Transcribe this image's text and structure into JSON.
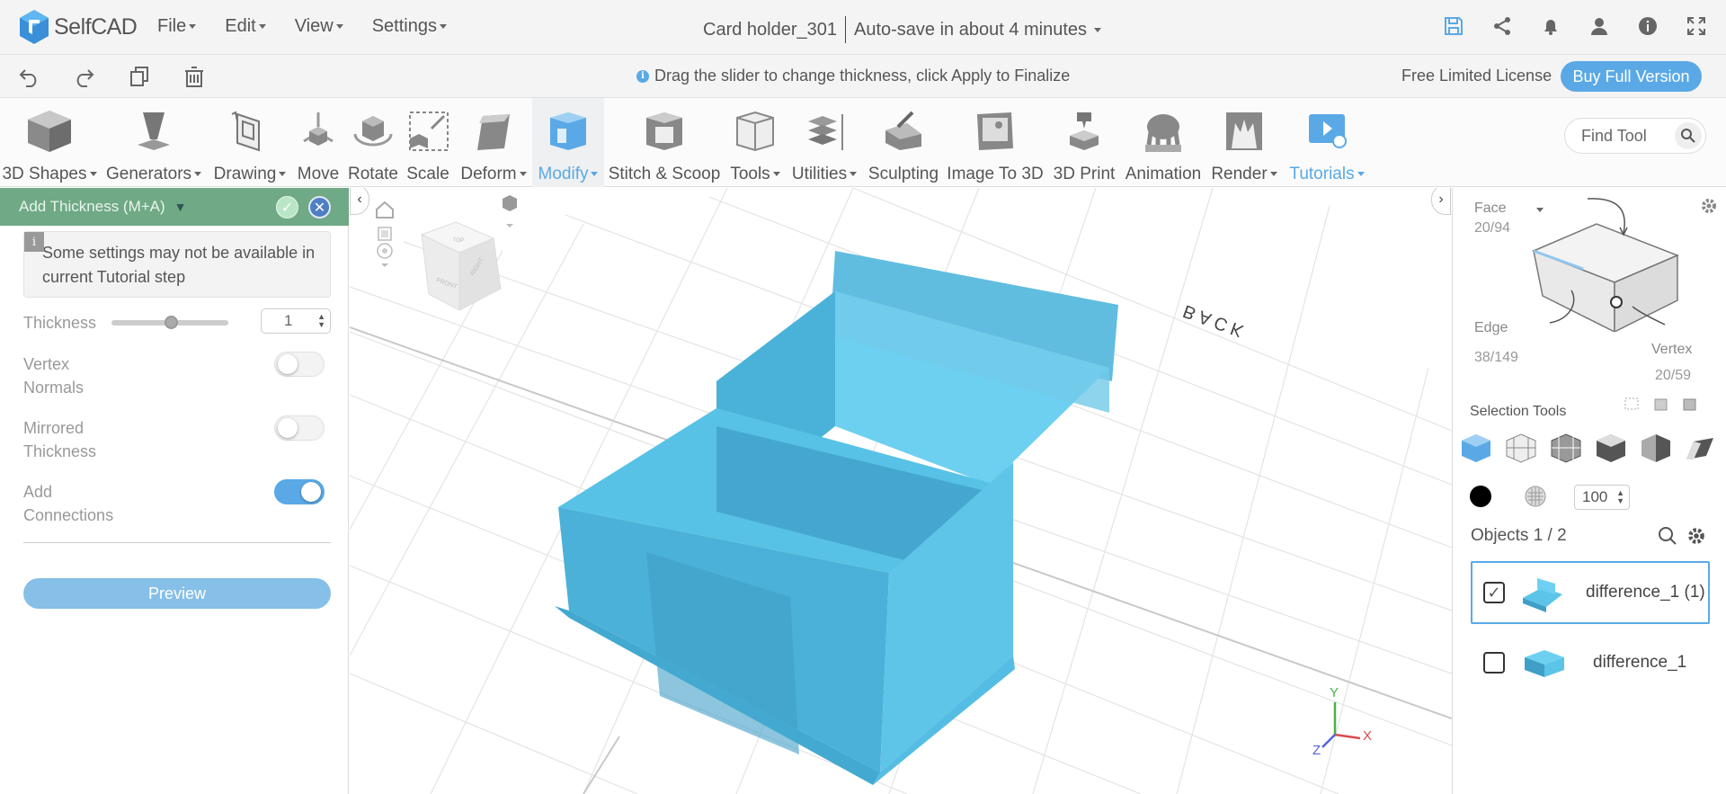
{
  "app": {
    "logo_text": "SelfCAD"
  },
  "menu": {
    "items": [
      "File",
      "Edit",
      "View",
      "Settings"
    ]
  },
  "project": {
    "name": "Card holder_301",
    "autosave": "Auto-save in about 4 minutes"
  },
  "top_icons": [
    "save-icon",
    "share-icon",
    "bell-icon",
    "user-icon",
    "info-icon",
    "fullscreen-icon"
  ],
  "hint": {
    "text": "Drag the slider to change thickness, click Apply to Finalize"
  },
  "license": {
    "text": "Free Limited License",
    "buy_label": "Buy Full Version"
  },
  "toolbar": {
    "tools": [
      {
        "label": "3D Shapes",
        "dropdown": true
      },
      {
        "label": "Generators",
        "dropdown": true
      },
      {
        "label": "Drawing",
        "dropdown": true
      },
      {
        "label": "Move",
        "dropdown": false
      },
      {
        "label": "Rotate",
        "dropdown": false
      },
      {
        "label": "Scale",
        "dropdown": false
      },
      {
        "label": "Deform",
        "dropdown": true
      },
      {
        "label": "Modify",
        "dropdown": true
      },
      {
        "label": "Stitch & Scoop",
        "dropdown": false
      },
      {
        "label": "Tools",
        "dropdown": true
      },
      {
        "label": "Utilities",
        "dropdown": true
      },
      {
        "label": "Sculpting",
        "dropdown": false
      },
      {
        "label": "Image To 3D",
        "dropdown": false
      },
      {
        "label": "3D Print",
        "dropdown": false
      },
      {
        "label": "Animation",
        "dropdown": false
      },
      {
        "label": "Render",
        "dropdown": true
      },
      {
        "label": "Tutorials",
        "dropdown": true
      }
    ],
    "find_placeholder": "Find Tool"
  },
  "panel": {
    "title": "Add Thickness (M+A)",
    "notice": "Some settings may not be available in current Tutorial step",
    "thickness_label": "Thickness",
    "thickness_value": "1",
    "thickness_slider_fraction": 0.43,
    "vertex_normals_label": "Vertex Normals",
    "vertex_normals_on": false,
    "mirrored_label": "Mirrored Thickness",
    "mirrored_on": false,
    "connections_label": "Add Connections",
    "connections_on": true,
    "preview_label": "Preview"
  },
  "viewport": {
    "back_label": "BACK",
    "cube_labels": [
      "TOP",
      "FRONT",
      "RIGHT"
    ],
    "axes": [
      "Y",
      "Z",
      "X"
    ],
    "model_color": "#5bc4e8"
  },
  "right_panel": {
    "face_label": "Face",
    "face_count": "20/94",
    "edge_label": "Edge",
    "edge_count": "38/149",
    "vertex_label": "Vertex",
    "vertex_count": "20/59",
    "selection_tools_label": "Selection Tools",
    "opacity_value": "100",
    "objects_label": "Objects 1 / 2",
    "objects": [
      {
        "name": "difference_1 (1)",
        "checked": true
      },
      {
        "name": "difference_1",
        "checked": false
      }
    ]
  },
  "colors": {
    "accent": "#5aa9e6",
    "panel_header": "#6fa985",
    "model": "#5bc4e8"
  }
}
